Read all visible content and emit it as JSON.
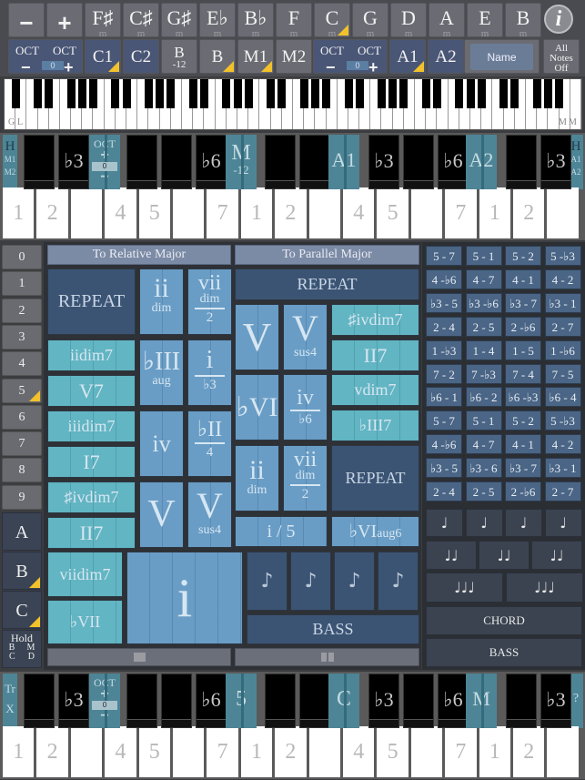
{
  "top_bar": {
    "row1": [
      {
        "label": "−",
        "sub": ""
      },
      {
        "label": "+",
        "sub": ""
      },
      {
        "label": "F♯",
        "sub": "m"
      },
      {
        "label": "C♯",
        "sub": "m"
      },
      {
        "label": "G♯",
        "sub": "m"
      },
      {
        "label": "E♭",
        "sub": "m"
      },
      {
        "label": "B♭",
        "sub": "m"
      },
      {
        "label": "F",
        "sub": "m"
      },
      {
        "label": "C",
        "sub": "m",
        "marked": true
      },
      {
        "label": "G",
        "sub": "m"
      },
      {
        "label": "D",
        "sub": "m"
      },
      {
        "label": "A",
        "sub": "m"
      },
      {
        "label": "E",
        "sub": "m"
      },
      {
        "label": "B",
        "sub": "m"
      }
    ],
    "info_label": "i",
    "row2": {
      "oct_left": {
        "label": "OCT",
        "minus": "−",
        "plus": "+",
        "value": "0"
      },
      "buttons": [
        {
          "label": "C1",
          "sub": "",
          "marked": true
        },
        {
          "label": "C2",
          "sub": ""
        },
        {
          "label": "B",
          "sub": "-12"
        },
        {
          "label": "B",
          "sub": "",
          "marked": true
        },
        {
          "label": "M1",
          "sub": "",
          "marked": true
        },
        {
          "label": "M2",
          "sub": ""
        }
      ],
      "oct_right": {
        "label": "OCT",
        "minus": "−",
        "plus": "+",
        "value": "0"
      },
      "buttons2": [
        {
          "label": "A1",
          "marked": true
        },
        {
          "label": "A2"
        }
      ],
      "name_label": "Name",
      "all_notes_off": [
        "All",
        "Notes",
        "Off"
      ]
    }
  },
  "mini_keyboard": {
    "left_labels": [
      "G",
      "L"
    ],
    "right_labels": [
      "M",
      "M"
    ]
  },
  "upper_piano": {
    "left_tab": [
      "H",
      "M1",
      "M2"
    ],
    "right_tab": [
      "H",
      "A1",
      "A2"
    ],
    "oct": {
      "label": "OCT",
      "plus": "+",
      "value": "0",
      "minus": "−"
    },
    "black_labels": [
      "",
      "♭3",
      "",
      "",
      "♭6",
      "",
      "",
      "",
      "♭3",
      "",
      "♭6",
      "",
      "",
      "♭3"
    ],
    "markers": [
      {
        "label": "M",
        "sub": "-12"
      },
      {
        "label": "A1",
        "sub": ""
      },
      {
        "label": "A2",
        "sub": ""
      }
    ],
    "white_labels": [
      "1",
      "2",
      "",
      "4",
      "5",
      "",
      "7",
      "1",
      "2",
      "",
      "4",
      "5",
      "",
      "7",
      "1",
      "2",
      ""
    ]
  },
  "number_column": [
    "0",
    "1",
    "2",
    "3",
    "4",
    "5",
    "6",
    "7",
    "8",
    "9"
  ],
  "letter_column": [
    "A",
    "B",
    "C"
  ],
  "hold": {
    "label": "Hold",
    "keys": [
      "B",
      "M",
      "C",
      "D"
    ]
  },
  "chord_panel": {
    "relative_header": "To Relative Major",
    "parallel_header": "To Parallel Major",
    "left": {
      "repeat": "REPEAT",
      "lights": [
        "iidim7",
        "V7",
        "iiidim7",
        "I7",
        "♯ivdim7",
        "II7",
        "viidim7",
        "♭VII"
      ],
      "ii_dim": {
        "main": "ii",
        "sub": "dim"
      },
      "vii_dim_2": {
        "main": "vii",
        "sub": "dim",
        "frac": "2"
      },
      "bIII_aug": {
        "main": "♭III",
        "sub": "aug"
      },
      "i_b3": {
        "main": "i",
        "frac": "♭3"
      },
      "iv": {
        "main": "iv"
      },
      "bII_4": {
        "main": "♭II",
        "frac": "4"
      },
      "V": {
        "main": "V"
      },
      "Vsus4": {
        "main": "V",
        "sub": "sus4"
      },
      "i_big": "i"
    },
    "right": {
      "repeat_top": "REPEAT",
      "V": {
        "main": "V"
      },
      "Vsus4": {
        "main": "V",
        "sub": "sus4"
      },
      "lights": [
        "♯ivdim7",
        "II7",
        "vdim7",
        "♭III7"
      ],
      "bVI": {
        "main": "♭VI"
      },
      "iv_b6": {
        "main": "iv",
        "frac": "♭6"
      },
      "ii_dim": {
        "main": "ii",
        "sub": "dim"
      },
      "vii_dim_2": {
        "main": "vii",
        "sub": "dim",
        "frac": "2"
      },
      "repeat_mid": "REPEAT",
      "i_5": "i / 5",
      "bVIaug6": {
        "main": "♭VI",
        "sub": "aug6"
      },
      "notes": [
        "♪",
        "♪",
        "♪",
        "♪"
      ],
      "bass": "BASS"
    },
    "stop_icon": "stop-icon",
    "pause_icon": "pause-icon"
  },
  "interval_grid": [
    [
      "5 - 7",
      "5 - 1",
      "5 - 2",
      "5 -♭3"
    ],
    [
      "4 -♭6",
      "4 - 7",
      "4 - 1",
      "4 - 2"
    ],
    [
      "♭3 - 5",
      "♭3 -♭6",
      "♭3 - 7",
      "♭3 - 1"
    ],
    [
      "2 - 4",
      "2 - 5",
      "2 -♭6",
      "2 - 7"
    ],
    [
      "1 -♭3",
      "1 - 4",
      "1 - 5",
      "1 -♭6"
    ],
    [
      "7 - 2",
      "7 -♭3",
      "7 - 4",
      "7 - 5"
    ],
    [
      "♭6 - 1",
      "♭6 - 2",
      "♭6 -♭3",
      "♭6 - 4"
    ],
    [
      "5 - 7",
      "5 - 1",
      "5 - 2",
      "5 -♭3"
    ],
    [
      "4 -♭6",
      "4 - 7",
      "4 - 1",
      "4 - 2"
    ],
    [
      "♭3 - 5",
      "♭3 - 6",
      "♭3 - 7",
      "♭3 - 1"
    ],
    [
      "2 - 4",
      "2 - 5",
      "2 -♭6",
      "2 - 7"
    ]
  ],
  "rhythm": {
    "row1": [
      "♩",
      "♩",
      "♩",
      "♩"
    ],
    "row2": [
      "♩♩",
      "♩♩",
      "♩♩"
    ],
    "row3": [
      "♩♩♩",
      "♩♩♩"
    ],
    "chord": "CHORD",
    "bass": "BASS"
  },
  "lower_piano": {
    "left_tab": [
      "Tr",
      "X"
    ],
    "right_tab": "?",
    "oct": {
      "label": "OCT",
      "plus": "+",
      "value": "0",
      "minus": "−"
    },
    "black_labels": [
      "",
      "♭3",
      "",
      "",
      "♭6",
      "",
      "",
      "",
      "♭3",
      "",
      "♭6",
      "",
      "",
      "♭3"
    ],
    "markers": [
      {
        "label": "5"
      },
      {
        "label": "C"
      },
      {
        "label": "M"
      }
    ],
    "white_labels": [
      "1",
      "2",
      "",
      "4",
      "5",
      "",
      "7",
      "1",
      "2",
      "",
      "4",
      "5",
      "",
      "7",
      "1",
      "2",
      ""
    ]
  }
}
